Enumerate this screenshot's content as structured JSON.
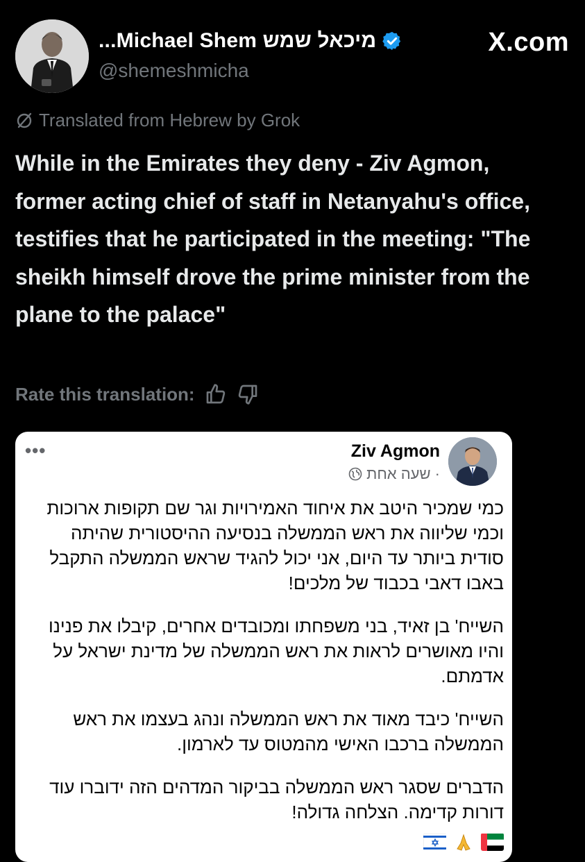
{
  "header": {
    "display_name": "...Michael Shem מיכאל שמש",
    "handle": "@shemeshmicha",
    "site": "X.com"
  },
  "tweet": {
    "translated_label": "Translated from Hebrew by Grok",
    "text": "While in the Emirates they deny - Ziv Agmon, former acting chief of staff in Netanyahu's office, testifies that he participated in the meeting: \"The sheikh himself drove the prime minister from the plane to the palace\"",
    "rate_label": "Rate this translation:"
  },
  "card": {
    "menu": "•••",
    "author": "Ziv Agmon",
    "time": "שעה אחת ·",
    "paragraphs": [
      "כמי שמכיר היטב את איחוד האמירויות וגר שם תקופות ארוכות וכמי שליווה את ראש הממשלה בנסיעה ההיסטורית שהיתה סודית ביותר עד היום, אני יכול להגיד שראש הממשלה התקבל באבו דאבי בכבוד של מלכים!",
      "השייח' בן זאיד, בני משפחתו ומכובדים אחרים, קיבלו את פנינו והיו מאושרים לראות את ראש הממשלה של מדינת ישראל על אדמתם.",
      "השייח' כיבד מאוד את ראש הממשלה ונהג בעצמו את ראש הממשלה ברכבו האישי מהמטוס עד לארמון.",
      "הדברים שסגר ראש הממשלה בביקור המדהים הזה ידוברו עוד דורות קדימה. הצלחה גדולה!"
    ]
  },
  "icons": {
    "verified": "verified-badge-icon",
    "translate": "translate-icon",
    "like": "thumbs-up-icon",
    "dislike": "thumbs-down-icon",
    "globe": "globe-icon",
    "flags": [
      "israel-flag-icon",
      "praying-hands-icon",
      "uae-flag-icon"
    ]
  },
  "colors": {
    "background": "#000000",
    "text": "#e7e9ea",
    "muted": "#71767b",
    "verified_blue": "#1d9bf0",
    "card_bg": "#ffffff"
  }
}
